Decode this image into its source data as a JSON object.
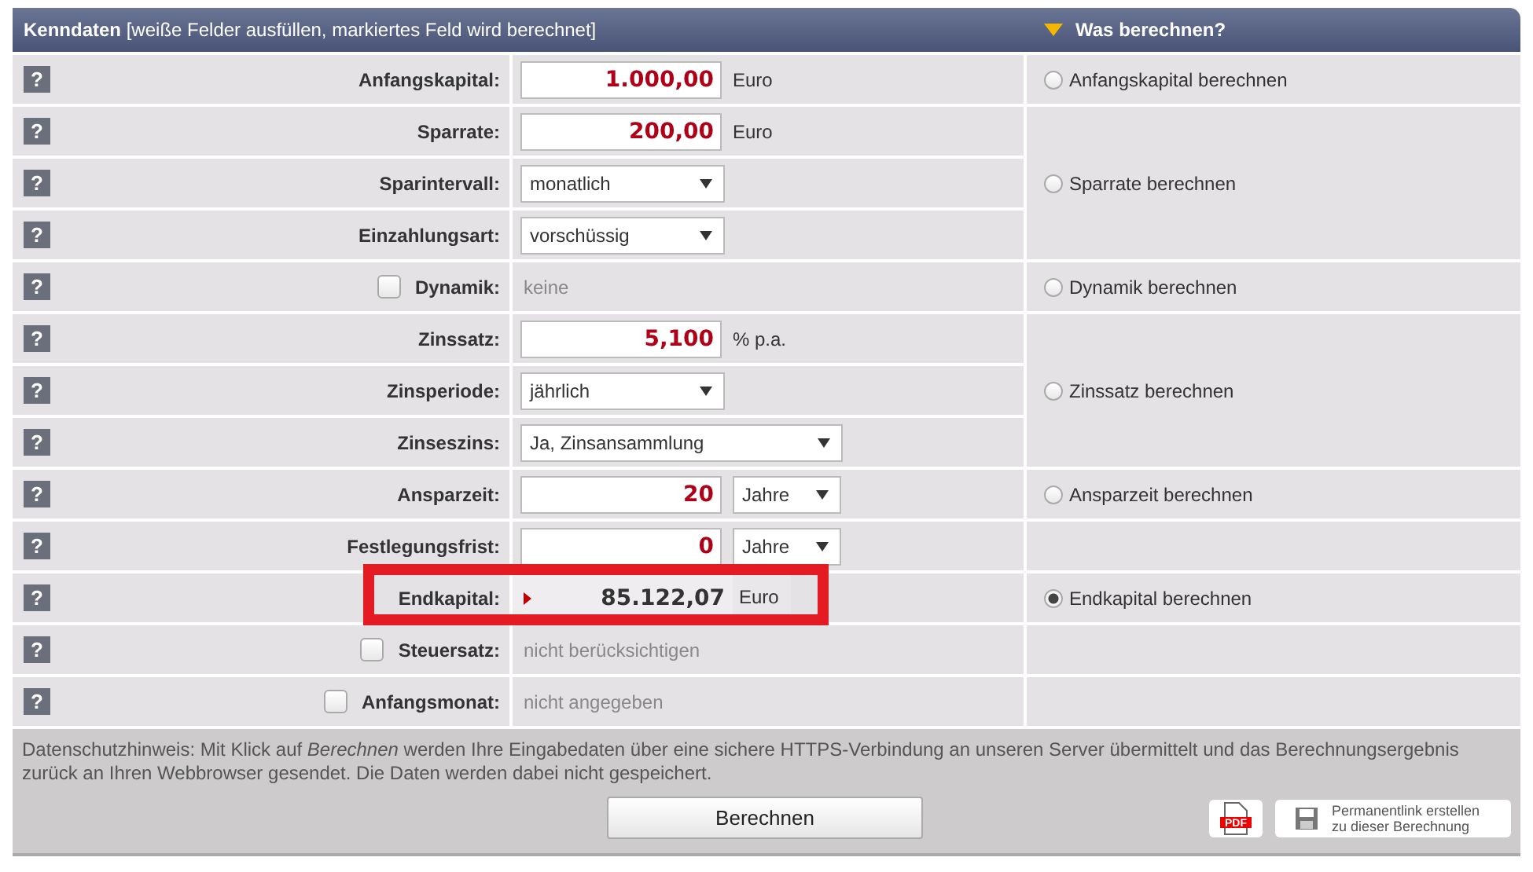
{
  "header": {
    "title": "Kenndaten",
    "hint": "[weiße Felder ausfüllen, markiertes Feld wird berechnet]",
    "side_title": "Was berechnen?"
  },
  "groups": [
    {
      "option": {
        "label": "Anfangskapital berechnen",
        "selected": false
      },
      "rows": [
        {
          "help": "?",
          "kind": "input",
          "label": "Anfangskapital:",
          "value": "1.000,00",
          "unit": "Euro"
        }
      ]
    },
    {
      "option": {
        "label": "Sparrate berechnen",
        "selected": false
      },
      "rows": [
        {
          "help": "?",
          "kind": "input",
          "label": "Sparrate:",
          "value": "200,00",
          "unit": "Euro"
        },
        {
          "help": "?",
          "kind": "select",
          "label": "Sparintervall:",
          "value": "monatlich"
        },
        {
          "help": "?",
          "kind": "select",
          "label": "Einzahlungsart:",
          "value": "vorschüssig"
        }
      ]
    },
    {
      "option": {
        "label": "Dynamik berechnen",
        "selected": false
      },
      "rows": [
        {
          "help": "?",
          "kind": "checkbox",
          "label": "Dynamik:",
          "checked": false,
          "note": "keine"
        }
      ]
    },
    {
      "option": {
        "label": "Zinssatz berechnen",
        "selected": false
      },
      "rows": [
        {
          "help": "?",
          "kind": "input",
          "label": "Zinssatz:",
          "value": "5,100",
          "unit": "% p.a."
        },
        {
          "help": "?",
          "kind": "select",
          "label": "Zinsperiode:",
          "value": "jährlich"
        },
        {
          "help": "?",
          "kind": "wide_select",
          "label": "Zinseszins:",
          "value": "Ja, Zinsansammlung"
        }
      ]
    },
    {
      "option": {
        "label": "Ansparzeit berechnen",
        "selected": false
      },
      "rows": [
        {
          "help": "?",
          "kind": "input_select",
          "label": "Ansparzeit:",
          "value": "20",
          "unit": "Jahre"
        }
      ]
    },
    {
      "rows": [
        {
          "help": "?",
          "kind": "input_select",
          "label": "Festlegungsfrist:",
          "value": "0",
          "unit": "Jahre"
        }
      ]
    },
    {
      "option": {
        "label": "Endkapital berechnen",
        "selected": true
      },
      "rows": [
        {
          "help": "?",
          "kind": "result",
          "label": "Endkapital:",
          "value": "85.122,07",
          "unit": "Euro"
        }
      ]
    },
    {
      "rows": [
        {
          "help": "?",
          "kind": "checkbox",
          "label": "Steuersatz:",
          "checked": false,
          "note": "nicht berücksichtigen"
        }
      ]
    },
    {
      "rows": [
        {
          "help": "?",
          "kind": "checkbox",
          "label": "Anfangsmonat:",
          "checked": false,
          "note": "nicht angegeben"
        }
      ]
    }
  ],
  "footer": {
    "notice": "Datenschutzhinweis: Mit Klick auf *Berechnen* werden Ihre Eingabedaten über eine sichere HTTPS-Verbindung an unseren Server übermittelt und das Berechnungsergebnis zurück an Ihren Webbrowser gesendet. Die Daten werden dabei nicht gespeichert.",
    "submit": "Berechnen",
    "pdf_label": "PDF",
    "permalink": [
      "Permanentlink erstellen",
      "zu dieser Berechnung"
    ]
  }
}
